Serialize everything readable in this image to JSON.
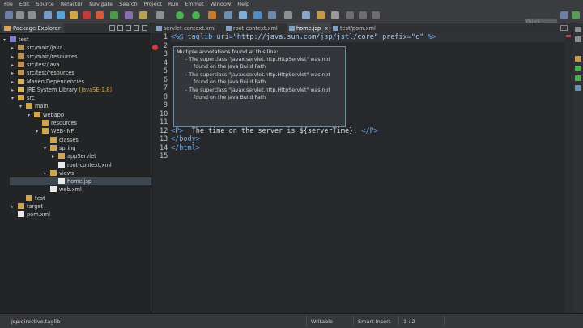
{
  "menu": [
    "File",
    "Edit",
    "Source",
    "Refactor",
    "Navigate",
    "Search",
    "Project",
    "Run",
    "Emmet",
    "Window",
    "Help"
  ],
  "toolbar": {
    "quick_access_placeholder": "Quick Access"
  },
  "explorer": {
    "title": "Package Explorer",
    "nodes": [
      {
        "label": "test",
        "depth": 0,
        "arrow": "▾",
        "icon": "proj"
      },
      {
        "label": "src/main/java",
        "depth": 1,
        "arrow": "▸",
        "icon": "pkg"
      },
      {
        "label": "src/main/resources",
        "depth": 1,
        "arrow": "▸",
        "icon": "pkg"
      },
      {
        "label": "src/test/java",
        "depth": 1,
        "arrow": "▸",
        "icon": "pkg"
      },
      {
        "label": "src/test/resources",
        "depth": 1,
        "arrow": "▸",
        "icon": "pkg"
      },
      {
        "label": "Maven Dependencies",
        "depth": 1,
        "arrow": "▸",
        "icon": "lib"
      },
      {
        "label": "JRE System Library",
        "suffix": "[JavaSE-1.8]",
        "depth": 1,
        "arrow": "▸",
        "icon": "lib"
      },
      {
        "label": "src",
        "depth": 1,
        "arrow": "▾",
        "icon": "fold"
      },
      {
        "label": "main",
        "depth": 2,
        "arrow": "▾",
        "icon": "fold"
      },
      {
        "label": "webapp",
        "depth": 3,
        "arrow": "▾",
        "icon": "fold"
      },
      {
        "label": "resources",
        "depth": 4,
        "arrow": "",
        "icon": "fold"
      },
      {
        "label": "WEB-INF",
        "depth": 4,
        "arrow": "▾",
        "icon": "fold"
      },
      {
        "label": "classes",
        "depth": 5,
        "arrow": "",
        "icon": "fold"
      },
      {
        "label": "spring",
        "depth": 5,
        "arrow": "▾",
        "icon": "fold"
      },
      {
        "label": "appServlet",
        "depth": 6,
        "arrow": "▸",
        "icon": "fold"
      },
      {
        "label": "root-context.xml",
        "depth": 6,
        "arrow": "",
        "icon": "file"
      },
      {
        "label": "views",
        "depth": 5,
        "arrow": "▾",
        "icon": "fold"
      },
      {
        "label": "home.jsp",
        "depth": 6,
        "arrow": "",
        "icon": "file",
        "selected": true
      },
      {
        "label": "web.xml",
        "depth": 5,
        "arrow": "",
        "icon": "file"
      },
      {
        "label": "test",
        "depth": 2,
        "arrow": "",
        "icon": "fold"
      },
      {
        "label": "target",
        "depth": 1,
        "arrow": "▸",
        "icon": "fold"
      },
      {
        "label": "pom.xml",
        "depth": 1,
        "arrow": "",
        "icon": "file"
      }
    ]
  },
  "tabs": [
    {
      "label": "servlet-context.xml",
      "active": false
    },
    {
      "label": "root-context.xml",
      "active": false
    },
    {
      "label": "home.jsp",
      "active": true,
      "close": "✕"
    },
    {
      "label": "test/pom.xml",
      "active": false
    }
  ],
  "editor": {
    "line_numbers": [
      "1",
      "2",
      "3",
      "4",
      "5",
      "6",
      "7",
      "8",
      "9",
      "10",
      "11",
      "12",
      "13",
      "14",
      "15"
    ],
    "line1": {
      "open": "<%@ ",
      "kw": "taglib",
      "sp1": " ",
      "a1": "uri=",
      "v1": "\"http://java.sun.com/jsp/jstl/core\"",
      "sp2": " ",
      "a2": "prefix=",
      "v2": "\"c\"",
      "close": " %>"
    },
    "line12": {
      "t1": "<P>",
      "text": "  The time on the server is ${serverTime}. ",
      "t2": "</P>"
    },
    "line13": "</body>",
    "line14": "</html>"
  },
  "hover": {
    "title": "Multiple annotations found at this line:",
    "lines": [
      "- The superclass \"javax.servlet.http.HttpServlet\" was not",
      "found on the Java Build Path",
      "- The superclass \"javax.servlet.http.HttpServlet\" was not",
      "found on the Java Build Path",
      "- The superclass \"javax.servlet.http.HttpServlet\" was not",
      "found on the Java Build Path"
    ]
  },
  "status": {
    "element": "jsp:directive.taglib",
    "mode": "Writable",
    "insert": "Smart Insert",
    "position": "1 : 2"
  },
  "colors": {
    "error": "#d43a3a",
    "accent": "#78a9e0"
  }
}
